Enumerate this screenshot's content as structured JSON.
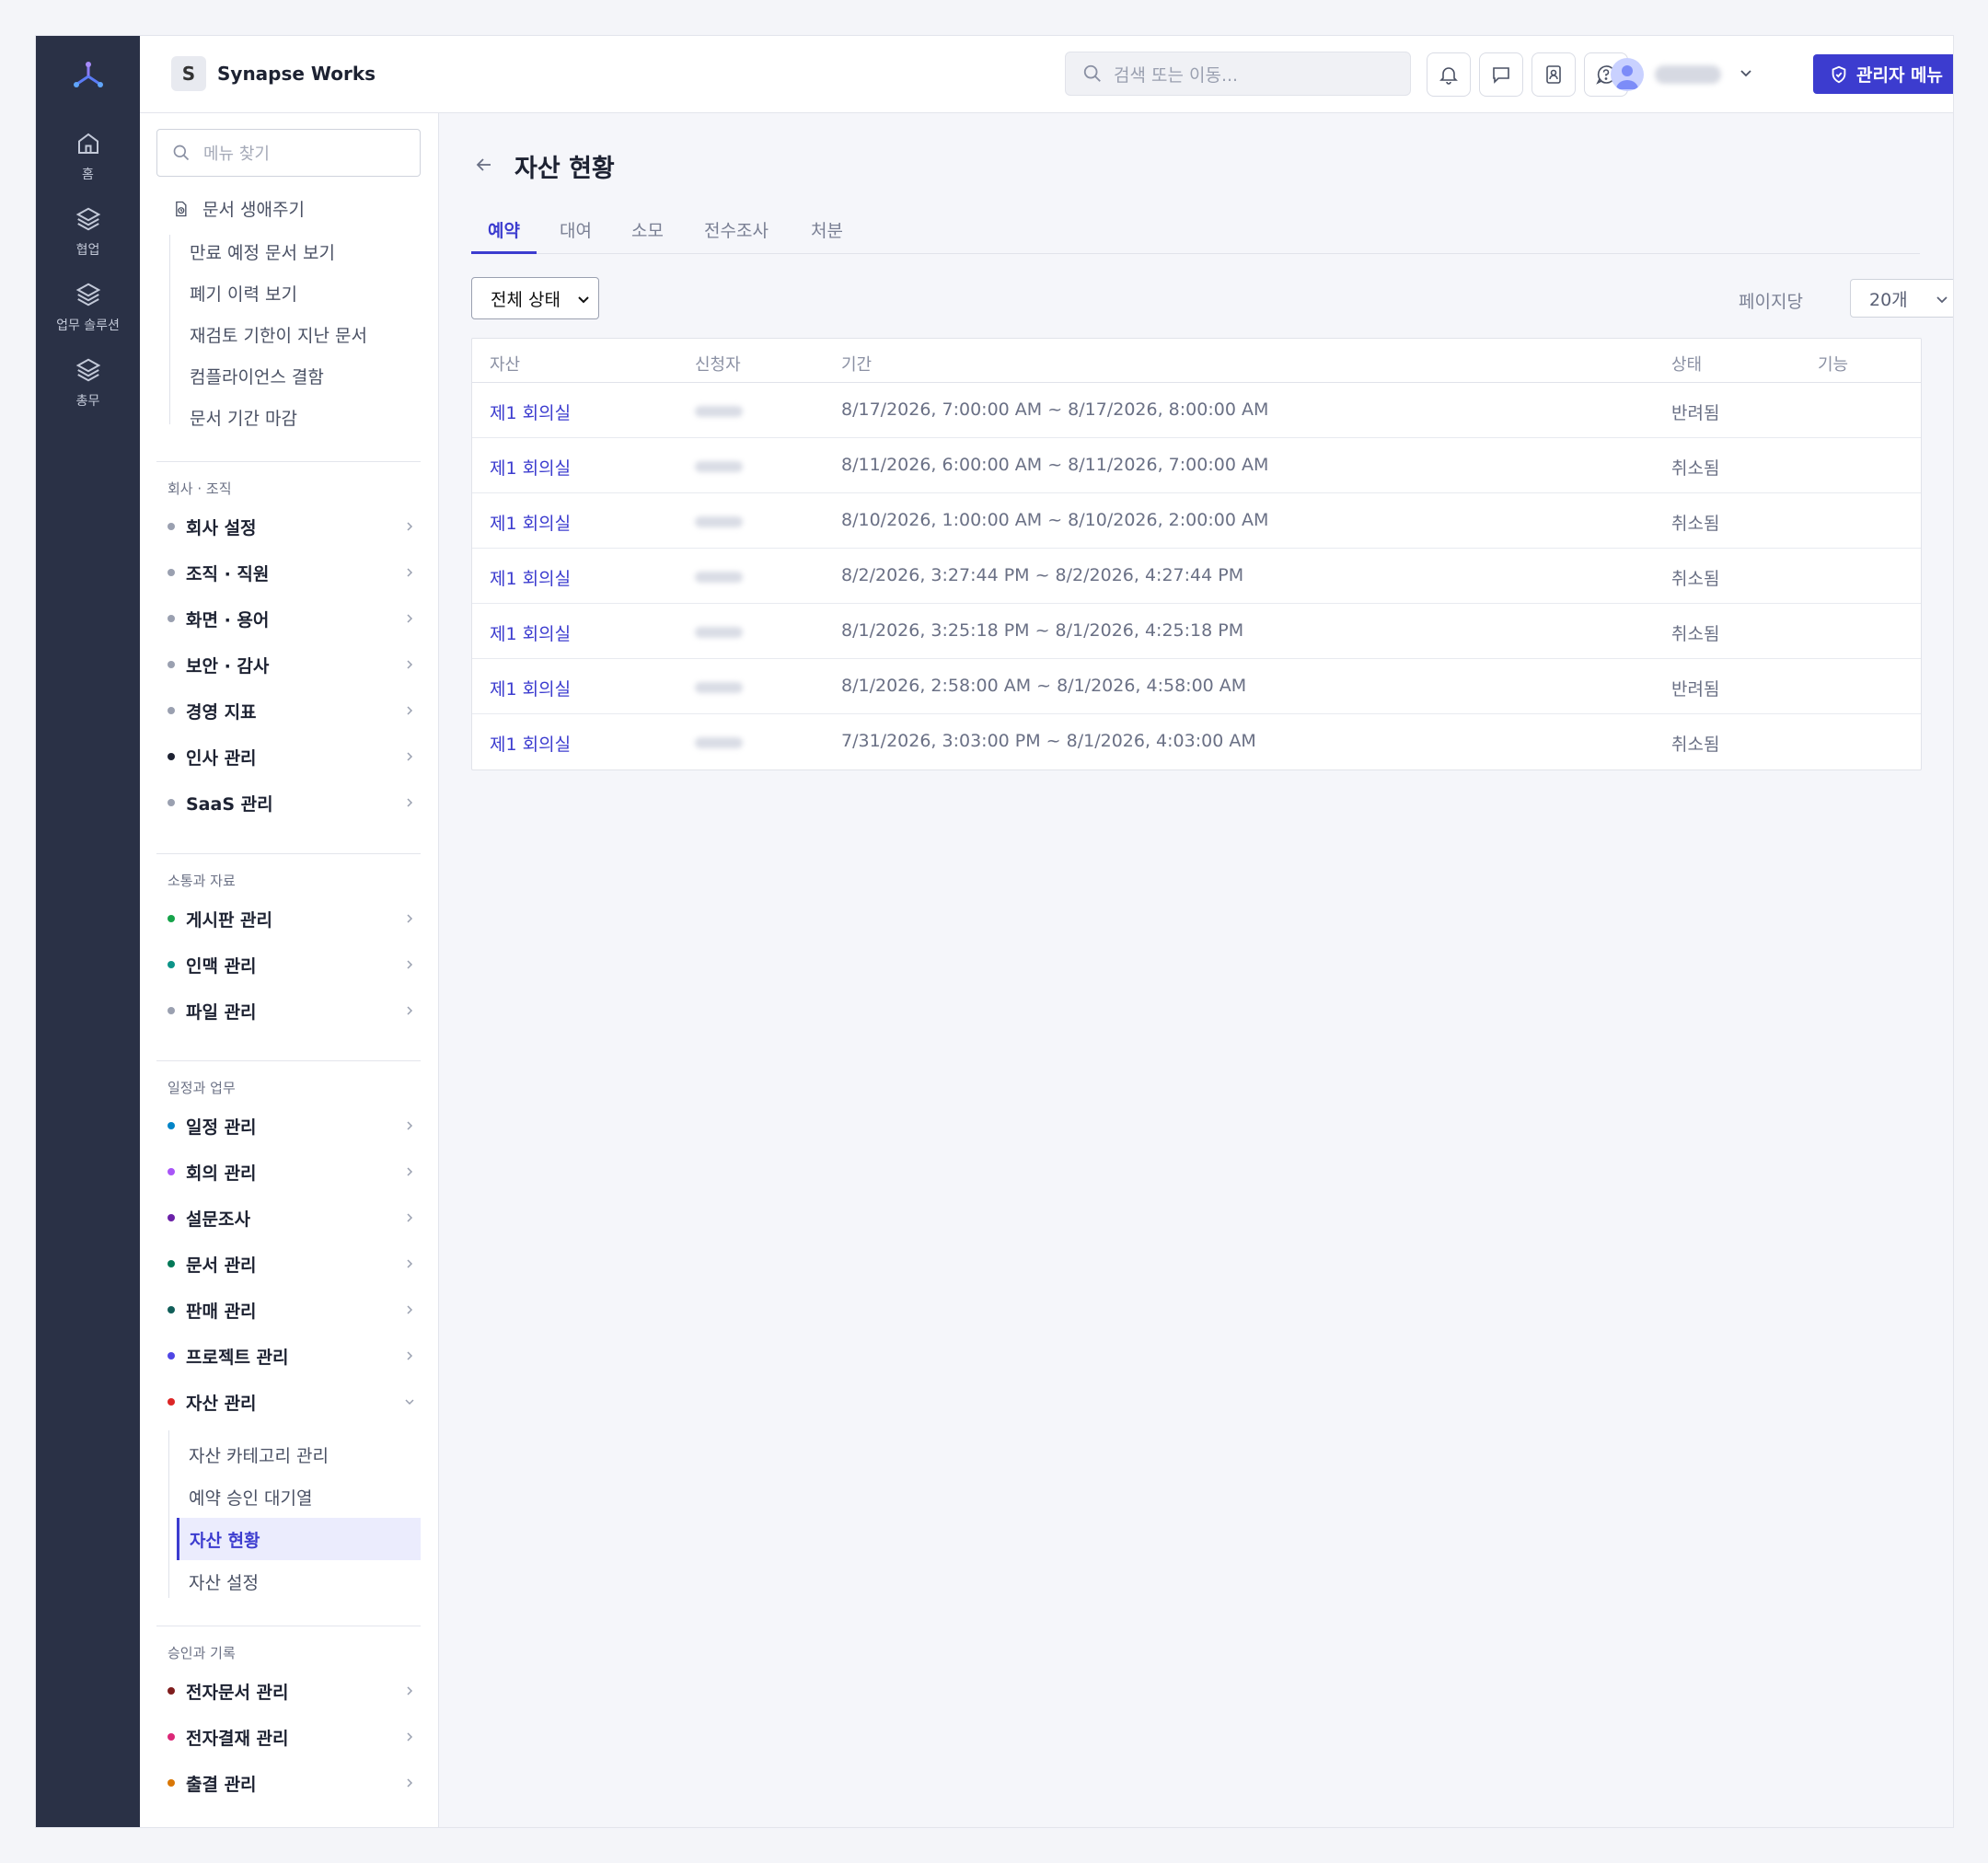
{
  "rail": {
    "items": [
      {
        "label": "홈",
        "icon": "home-icon"
      },
      {
        "label": "협업",
        "icon": "layers-icon"
      },
      {
        "label": "업무 솔루션",
        "icon": "layers-icon"
      },
      {
        "label": "총무",
        "icon": "layers-icon"
      }
    ]
  },
  "topbar": {
    "workspace_initial": "S",
    "workspace_name": "Synapse Works",
    "search_placeholder": "검색 또는 이동...",
    "admin_label": "관리자 메뉴"
  },
  "sidebar": {
    "search_placeholder": "메뉴 찾기",
    "lifecycle": {
      "label": "문서 생애주기",
      "items": [
        "만료 예정 문서 보기",
        "폐기 이력 보기",
        "재검토 기한이 지난 문서",
        "컴플라이언스 결함",
        "문서 기간 마감"
      ]
    },
    "sections": [
      {
        "label": "회사 · 조직",
        "items": [
          {
            "label": "회사 설정",
            "color": "#9aa0b0"
          },
          {
            "label": "조직 · 직원",
            "color": "#9aa0b0"
          },
          {
            "label": "화면 · 용어",
            "color": "#9aa0b0"
          },
          {
            "label": "보안 · 감사",
            "color": "#9aa0b0"
          },
          {
            "label": "경영 지표",
            "color": "#9aa0b0"
          },
          {
            "label": "인사 관리",
            "color": "#1d2232"
          },
          {
            "label": "SaaS 관리",
            "color": "#9aa0b0"
          }
        ]
      },
      {
        "label": "소통과 자료",
        "items": [
          {
            "label": "게시판 관리",
            "color": "#16a34a"
          },
          {
            "label": "인맥 관리",
            "color": "#0d9488"
          },
          {
            "label": "파일 관리",
            "color": "#9aa0b0"
          }
        ]
      },
      {
        "label": "일정과 업무",
        "items": [
          {
            "label": "일정 관리",
            "color": "#0284c7"
          },
          {
            "label": "회의 관리",
            "color": "#a855f7"
          },
          {
            "label": "설문조사",
            "color": "#6b21a8"
          },
          {
            "label": "문서 관리",
            "color": "#047857"
          },
          {
            "label": "판매 관리",
            "color": "#115e59"
          },
          {
            "label": "프로젝트 관리",
            "color": "#4f46e5"
          },
          {
            "label": "자산 관리",
            "color": "#dc2626"
          }
        ]
      },
      {
        "label": "승인과 기록",
        "items": [
          {
            "label": "전자문서 관리",
            "color": "#7f1d1d"
          },
          {
            "label": "전자결재 관리",
            "color": "#db2777"
          },
          {
            "label": "출결 관리",
            "color": "#d97706"
          }
        ]
      }
    ],
    "asset_sub": [
      "자산 카테고리 관리",
      "예약 승인 대기열",
      "자산 현황",
      "자산 설정"
    ]
  },
  "main": {
    "title": "자산 현황",
    "tabs": [
      "예약",
      "대여",
      "소모",
      "전수조사",
      "처분"
    ],
    "status_filter": "전체 상태",
    "per_page_label": "페이지당",
    "per_page_value": "20개",
    "columns": [
      "자산",
      "신청자",
      "기간",
      "상태",
      "기능"
    ],
    "rows": [
      {
        "asset": "제1 회의실",
        "period": "8/17/2026, 7:00:00 AM ~ 8/17/2026, 8:00:00 AM",
        "status": "반려됨"
      },
      {
        "asset": "제1 회의실",
        "period": "8/11/2026, 6:00:00 AM ~ 8/11/2026, 7:00:00 AM",
        "status": "취소됨"
      },
      {
        "asset": "제1 회의실",
        "period": "8/10/2026, 1:00:00 AM ~ 8/10/2026, 2:00:00 AM",
        "status": "취소됨"
      },
      {
        "asset": "제1 회의실",
        "period": "8/2/2026, 3:27:44 PM ~ 8/2/2026, 4:27:44 PM",
        "status": "취소됨"
      },
      {
        "asset": "제1 회의실",
        "period": "8/1/2026, 3:25:18 PM ~ 8/1/2026, 4:25:18 PM",
        "status": "취소됨"
      },
      {
        "asset": "제1 회의실",
        "period": "8/1/2026, 2:58:00 AM ~ 8/1/2026, 4:58:00 AM",
        "status": "반려됨"
      },
      {
        "asset": "제1 회의실",
        "period": "7/31/2026, 3:03:00 PM ~ 8/1/2026, 4:03:00 AM",
        "status": "취소됨"
      }
    ]
  },
  "colors": {
    "accent": "#3c3ccf",
    "rail_bg": "#2a3146"
  }
}
